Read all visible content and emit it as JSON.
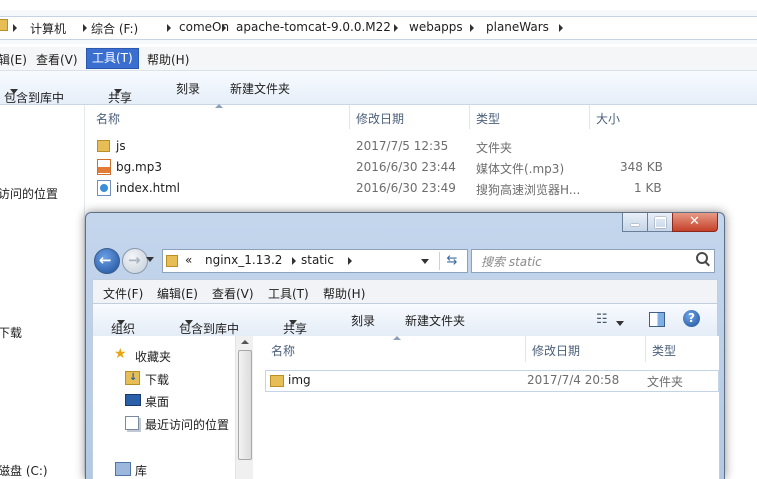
{
  "back_window": {
    "breadcrumb": [
      "计算机",
      "综合 (F:)",
      "comeOn",
      "apache-tomcat-9.0.0.M22",
      "webapps",
      "planeWars"
    ],
    "menu": [
      "编辑(E)",
      "查看(V)",
      "工具(T)",
      "帮助(H)"
    ],
    "menu_display": [
      "辑(E)",
      "查看(V)",
      "工具(T)",
      "帮助(H)"
    ],
    "toolbar": [
      "包含到库中",
      "共享",
      "刻录",
      "新建文件夹"
    ],
    "nav_items": [
      "访问的位置",
      "下载",
      "磁盘 (C:)"
    ],
    "columns": [
      "名称",
      "修改日期",
      "类型",
      "大小"
    ],
    "files": [
      {
        "name": "js",
        "date": "2017/7/5 12:35",
        "type": "文件夹",
        "size": ""
      },
      {
        "name": "bg.mp3",
        "date": "2016/6/30 23:44",
        "type": "媒体文件(.mp3)",
        "size": "348 KB"
      },
      {
        "name": "index.html",
        "date": "2016/6/30 23:49",
        "type": "搜狗高速浏览器H...",
        "size": "1 KB"
      }
    ]
  },
  "front_window": {
    "address_prefix": "«",
    "breadcrumb": [
      "nginx_1.13.2",
      "static"
    ],
    "search_placeholder": "搜索 static",
    "menu": [
      "文件(F)",
      "编辑(E)",
      "查看(V)",
      "工具(T)",
      "帮助(H)"
    ],
    "toolbar": [
      "组织",
      "包含到库中",
      "共享",
      "刻录",
      "新建文件夹"
    ],
    "nav": {
      "favorites_label": "收藏夹",
      "items": [
        "下载",
        "桌面",
        "最近访问的位置"
      ],
      "library_label": "库"
    },
    "columns": [
      "名称",
      "修改日期",
      "类型"
    ],
    "files": [
      {
        "name": "img",
        "date": "2017/7/4 20:58",
        "type": "文件夹"
      }
    ]
  },
  "colors": {
    "accent": "#3a6fd0",
    "folder": "#e6be55",
    "header_text": "#4c607a"
  }
}
